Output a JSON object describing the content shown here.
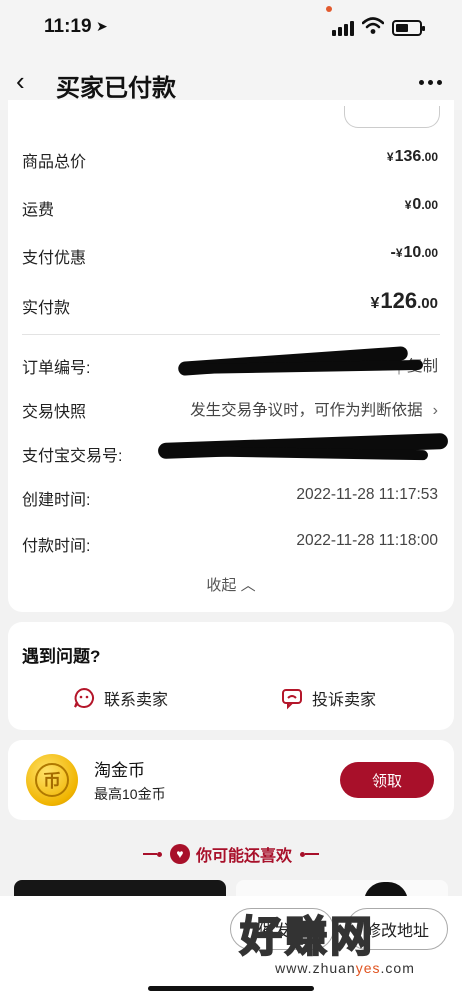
{
  "status": {
    "time": "11:19"
  },
  "nav": {
    "title": "买家已付款"
  },
  "order": {
    "goods_total": {
      "label": "商品总价",
      "currency": "¥",
      "int": "136",
      "dec": ".00"
    },
    "shipping": {
      "label": "运费",
      "currency": "¥",
      "int": "0",
      "dec": ".00"
    },
    "discount": {
      "label": "支付优惠",
      "prefix": "-",
      "currency": "¥",
      "int": "10",
      "dec": ".00"
    },
    "paid": {
      "label": "实付款",
      "currency": "¥",
      "int": "126",
      "dec": ".00"
    },
    "order_no": {
      "label": "订单编号:",
      "copy": "复制"
    },
    "snapshot": {
      "label": "交易快照",
      "value": "发生交易争议时，可作为判断依据"
    },
    "alipay_no": {
      "label": "支付宝交易号:"
    },
    "created": {
      "label": "创建时间:",
      "value": "2022-11-28 11:17:53"
    },
    "paid_time": {
      "label": "付款时间:",
      "value": "2022-11-28 11:18:00"
    },
    "collapse": "收起"
  },
  "issue": {
    "title": "遇到问题?",
    "contact": "联系卖家",
    "complain": "投诉卖家"
  },
  "coin": {
    "icon_glyph": "币",
    "title": "淘金币",
    "subtitle": "最高10金币",
    "claim": "领取"
  },
  "recommend": {
    "heading": "你可能还喜欢"
  },
  "bottom": {
    "btn1": "催发货",
    "btn2": "修改地址"
  },
  "watermark": {
    "cn": "好赚网",
    "url_a": "www.zhuan",
    "url_b": "yes",
    "url_c": ".com"
  },
  "colors": {
    "accent": "#a8102a",
    "price_red": "#b4162a",
    "background": "#f2f2f2"
  },
  "icons": [
    "back-arrow-icon",
    "more-icon",
    "location-arrow-icon",
    "signal-icon",
    "wifi-icon",
    "battery-icon",
    "chevron-right-icon",
    "chevron-up-icon",
    "chat-face-icon",
    "complaint-icon",
    "coin-icon",
    "heart-icon"
  ]
}
